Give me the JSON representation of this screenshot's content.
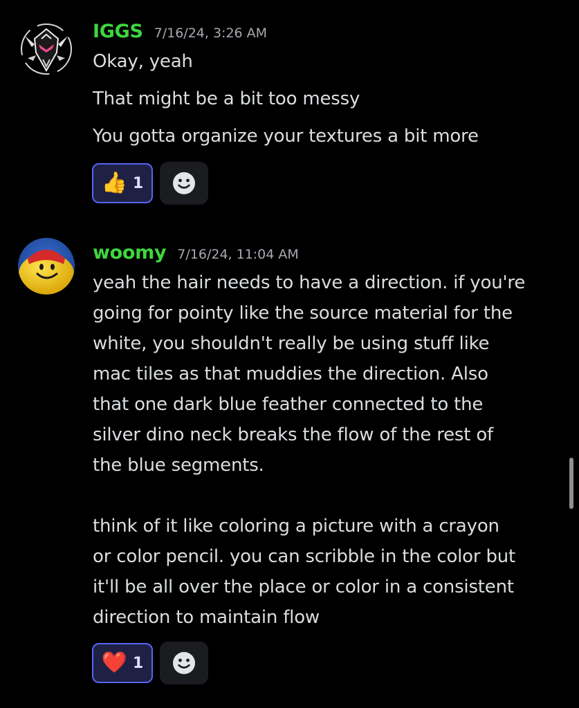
{
  "messages": [
    {
      "username": "IGGS",
      "timestamp": "7/16/24, 3:26 AM",
      "avatar_icon": "masked-figure-avatar",
      "lines": [
        "Okay, yeah",
        "That might be a bit too messy",
        "You gotta organize your textures a bit more"
      ],
      "reaction": {
        "emoji": "👍",
        "count": "1"
      },
      "add_reaction_icon": "smiley-add-reaction-icon"
    },
    {
      "username": "woomy",
      "timestamp": "7/16/24, 11:04 AM",
      "avatar_icon": "smiley-face-avatar",
      "lines": [
        "yeah the hair needs to have a direction. if you're",
        "going for pointy like the source material for the",
        "white, you shouldn't really be using stuff like",
        "mac tiles as that muddies the direction. Also",
        "that one dark blue feather connected to the",
        "silver dino neck breaks the flow of the rest of",
        "the blue segments.",
        "",
        "think of it like coloring a picture with a crayon",
        "or color pencil. you can scribble in the color but",
        "it'll be all over the place or color in a consistent",
        "direction to maintain flow"
      ],
      "reaction": {
        "emoji": "❤️",
        "count": "1"
      },
      "add_reaction_icon": "smiley-add-reaction-icon"
    }
  ],
  "colors": {
    "background": "#000000",
    "username": "#3ed63e",
    "timestamp": "#a6aab1",
    "text": "#dbdee1",
    "reaction_border": "#5865f2",
    "reaction_bg": "#1e2144"
  }
}
